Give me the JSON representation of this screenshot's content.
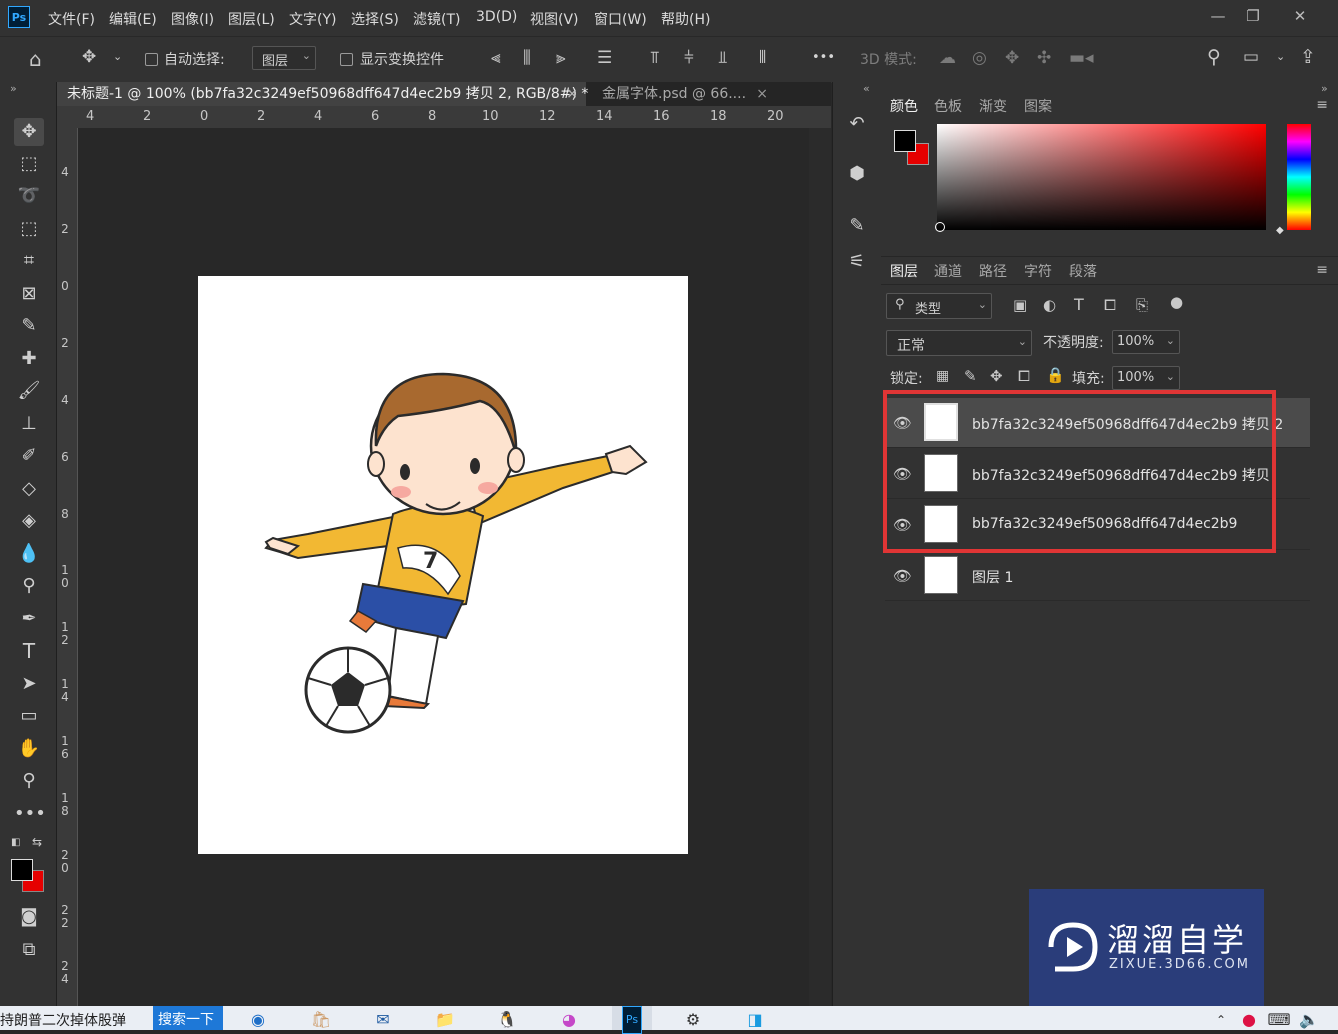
{
  "app": {
    "logo": "Ps"
  },
  "menu": [
    "文件(F)",
    "编辑(E)",
    "图像(I)",
    "图层(L)",
    "文字(Y)",
    "选择(S)",
    "滤镜(T)",
    "3D(D)",
    "视图(V)",
    "窗口(W)",
    "帮助(H)"
  ],
  "window_controls": {
    "minimize": "—",
    "restore": "❐",
    "close": "✕"
  },
  "options": {
    "auto_select_label": "自动选择:",
    "auto_select_target": "图层",
    "show_transform_label": "显示变换控件",
    "mode_3d_label": "3D 模式:",
    "more": "•••"
  },
  "tabs": [
    {
      "label": "未标题-1 @ 100% (bb7fa32c3249ef50968dff647d4ec2b9 拷贝 2, RGB/8#) *",
      "close": "×"
    },
    {
      "label": "金属字体.psd @ 66....",
      "close": "×"
    }
  ],
  "ruler_h": [
    "4",
    "2",
    "0",
    "2",
    "4",
    "6",
    "8",
    "10",
    "12",
    "14",
    "16",
    "18",
    "20"
  ],
  "ruler_v": [
    "4",
    "2",
    "0",
    "2",
    "4",
    "6",
    "8",
    "10",
    "12",
    "14",
    "16",
    "18",
    "20",
    "22",
    "24"
  ],
  "color_panel": {
    "tabs": [
      "颜色",
      "色板",
      "渐变",
      "图案"
    ],
    "foreground": "#000000",
    "background": "#e60000"
  },
  "layers_panel": {
    "tabs": [
      "图层",
      "通道",
      "路径",
      "字符",
      "段落"
    ],
    "filter_label": "类型",
    "blend_mode": "正常",
    "opacity_label": "不透明度:",
    "opacity_value": "100%",
    "lock_label": "锁定:",
    "fill_label": "填充:",
    "fill_value": "100%",
    "layers": [
      {
        "name": "bb7fa32c3249ef50968dff647d4ec2b9 拷贝 2",
        "selected": true
      },
      {
        "name": "bb7fa32c3249ef50968dff647d4ec2b9 拷贝",
        "selected": false
      },
      {
        "name": "bb7fa32c3249ef50968dff647d4ec2b9",
        "selected": false
      },
      {
        "name": "图层 1",
        "selected": false
      }
    ],
    "highlight_color": "#e03535"
  },
  "watermark": {
    "title": "溜溜自学",
    "url": "ZIXUE.3D66.COM"
  },
  "taskbar": {
    "text": "持朗普二次掉体股弹",
    "search_button": "搜索一下"
  },
  "colors": {
    "ps_blue": "#31a8ff",
    "panel_bg": "#323232",
    "canvas_bg": "#282828"
  }
}
